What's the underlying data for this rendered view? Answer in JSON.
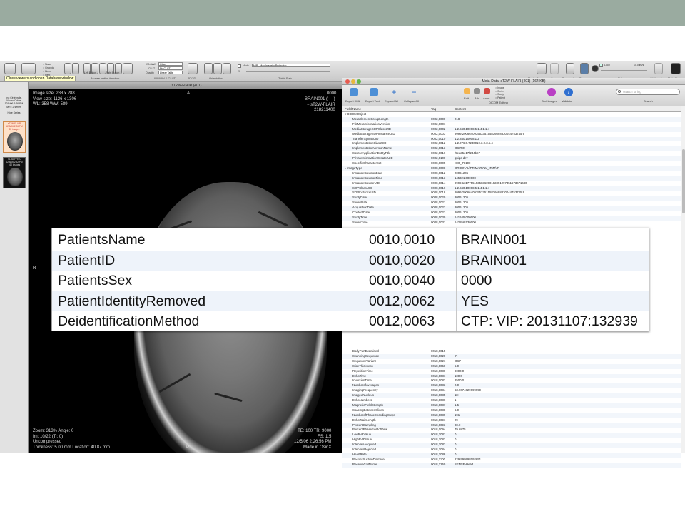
{
  "toolbar": {
    "tooltip": "Close viewers and open Database window",
    "mouse_button_function": "Mouse button function",
    "left_button": "Left Button",
    "right_button": "Right Button",
    "wlww_label": "WL/WW",
    "wlww_value": "Other",
    "clut_label": "CLUT",
    "clut_value": "No CLUT",
    "opacity_label": "Opacity",
    "opacity_value": "Linear Table",
    "wlww_clut": "WL/WW & CLUT",
    "tools_2d3d": "2D/3D",
    "orientation": "Orientation",
    "mode_label": "Mode",
    "mode_value": "MIP - Max Intensity Projection",
    "thick_slab": "Thick Slab",
    "slab_value": "20",
    "radio_options": [
      "None",
      "Graphic",
      "Blend",
      "Rest"
    ],
    "movie_export": "Movie Export",
    "sync": "Sync",
    "propagate": "Propagate",
    "browse": "Browse",
    "loop": "Loop",
    "rate_value": "10.0 im/s",
    "rate": "Rate",
    "three_d_panel": "3D Panel",
    "meta_data": "Meta-Data"
  },
  "sidebar": {
    "patient_info": "Ino Cérébrale,\nNeuro-Crâne\n12/5/06 2:26 PM\nMR : 2 series\n\nHide Series",
    "series": [
      {
        "text": "sT2W-FLAIR\n12/5/06 2:26 PM\n22 images",
        "selected": true
      },
      {
        "text": "T1-3D-FFE-C\n12/5/06 2:32 PM\n160 images",
        "selected": false
      }
    ]
  },
  "viewer": {
    "title": "sT2W-FLAIR (401)",
    "top_left": "Image size: 288 x 288\nView size: 1126 x 1306\nWL: 358 WW: 589",
    "top_right": "BRAIN001 (  -  )\n − sT2W-FLAIR\n218211400",
    "corner_top_right": "0000",
    "orient_top": "A",
    "orient_left": "R",
    "orient_bottom": "P",
    "bottom_left": "Zoom: 313% Angle: 0\nIm: 10/22 (Ti: 0)\nUncompressed\nThickness: 5.00 mm Location: 40.87 mm",
    "bottom_right": "TE: 100 TR: 9000\nFS: 1.5\n12/5/06 2:26:56 PM\nMade in OsiriX"
  },
  "meta": {
    "title": "Meta-Data: sT2W-FLAIR (401)     (164 KB)",
    "toolbar": {
      "export_xml": "Export XML",
      "export_text": "Export Text",
      "expand_all": "Expand All",
      "collapse_all": "Collapse All",
      "edit": "Edit",
      "add": "Add",
      "anon": "Anon",
      "dicom_editing": "DICOM Editing",
      "image_options": [
        "Image",
        "Series",
        "Study",
        "Patient"
      ],
      "sort_images": "Sort Images",
      "validator": "Validator",
      "search_placeholder": "search string",
      "search": "Search"
    },
    "columns": [
      "Field Name",
      "Tag",
      "Content"
    ],
    "rows_top": [
      [
        "▾ DICOMObject",
        "",
        ""
      ],
      [
        "MetaElementGroupLength",
        "0002,0000",
        "218"
      ],
      [
        "FileMetaInformationVersion",
        "0002,0001",
        ""
      ],
      [
        "MediaStorageSOPClassUID",
        "0002,0002",
        "1.2.840.10008.5.1.4.1.1.4"
      ],
      [
        "MediaStorageSOPInstanceUID",
        "0002,0003",
        "9999.20066409355335155836698830044753745 9"
      ],
      [
        "TransferSyntaxUID",
        "0002,0010",
        "1.2.840.10008.1.2"
      ],
      [
        "ImplementationClassUID",
        "0002,0012",
        "1.2.276.0.7230010.3.0.3.5.4"
      ],
      [
        "ImplementationVersionName",
        "0002,0013",
        "OSIRIX"
      ],
      [
        "SourceApplicationEntityTitle",
        "0002,0016",
        "f5ea35e17f234bb7"
      ],
      [
        "PrivateInformationCreatorUID",
        "0002,0100",
        "quipc-dev"
      ],
      [
        "SpecificCharacterSet",
        "0008,0005",
        "ISO_IR 100"
      ],
      [
        "▸ ImageType",
        "0008,0008",
        "ORIGINAL\\PRIMARY\\M_IR\\M\\IR"
      ],
      [
        "InstanceCreationDate",
        "0008,0012",
        "20061205"
      ],
      [
        "InstanceCreationTime",
        "0008,0013",
        "145321.000000"
      ],
      [
        "InstanceCreatorUID",
        "0008,0014",
        "9999.13177551535836090102391297451673671680"
      ],
      [
        "SOPClassUID",
        "0008,0016",
        "1.2.840.10008.5.1.4.1.1.4"
      ],
      [
        "SOPInstanceUID",
        "0008,0018",
        "9999.20066409355335155836698830044753745 9"
      ],
      [
        "StudyDate",
        "0008,0020",
        "20061205"
      ],
      [
        "SeriesDate",
        "0008,0021",
        "20061205"
      ],
      [
        "AcquisitionDate",
        "0008,0022",
        "20061205"
      ],
      [
        "ContentDate",
        "0008,0023",
        "20061205"
      ],
      [
        "StudyTime",
        "0008,0030",
        "141645.000000"
      ],
      [
        "SeriesTime",
        "0008,0031",
        "142856.530000"
      ]
    ],
    "rows_bottom": [
      [
        "BodyPartExamined",
        "0018,0015",
        ""
      ],
      [
        "ScanningSequence",
        "0018,0020",
        "IR"
      ],
      [
        "SequenceVariant",
        "0018,0021",
        "OSP"
      ],
      [
        "SliceThickness",
        "0018,0050",
        "5.0"
      ],
      [
        "RepetitionTime",
        "0018,0080",
        "9000.0"
      ],
      [
        "EchoTime",
        "0018,0081",
        "100.0"
      ],
      [
        "InversionTime",
        "0018,0082",
        "2500.0"
      ],
      [
        "NumberofAverages",
        "0018,0083",
        "2.0"
      ],
      [
        "ImagingFrequency",
        "0018,0084",
        "63.9074029999999"
      ],
      [
        "ImagedNucleus",
        "0018,0085",
        "1H"
      ],
      [
        "EchoNumbers",
        "0018,0086",
        "1"
      ],
      [
        "MagneticFieldStrength",
        "0018,0087",
        "1.5"
      ],
      [
        "SpacingBetweenSlices",
        "0018,0088",
        "6.0"
      ],
      [
        "NumberofPhaseEncodingSteps",
        "0018,0089",
        "191"
      ],
      [
        "EchoTrainLength",
        "0018,0091",
        "29"
      ],
      [
        "PercentSampling",
        "0018,0093",
        "80.0"
      ],
      [
        "PercentPhaseFieldofView",
        "0018,0094",
        "79.6875"
      ],
      [
        "LowR-RValue",
        "0018,1081",
        "0"
      ],
      [
        "HighR-RValue",
        "0018,1082",
        "0"
      ],
      [
        "IntervalsAcquired",
        "0018,1083",
        "0"
      ],
      [
        "IntervalsRejected",
        "0018,1084",
        "0"
      ],
      [
        "HeartRate",
        "0018,1088",
        "0"
      ],
      [
        "ReconstructionDiameter",
        "0018,1100",
        "229.999998092651"
      ],
      [
        "ReceiveCoilName",
        "0018,1250",
        "SENSE-Head"
      ]
    ]
  },
  "zoom": {
    "rows": [
      [
        "PatientsName",
        "0010,0010",
        "BRAIN001"
      ],
      [
        "PatientID",
        "0010,0020",
        "BRAIN001"
      ],
      [
        "PatientsSex",
        "0010,0040",
        "0000"
      ],
      [
        "PatientIdentityRemoved",
        "0012,0062",
        "YES"
      ],
      [
        "DeidentificationMethod",
        "0012,0063",
        "CTP: VIP: 20131107:132939"
      ]
    ]
  },
  "colors": {
    "band": "#9aaba0",
    "selection": "#ffe1c8",
    "stripe": "#eef3fa"
  }
}
